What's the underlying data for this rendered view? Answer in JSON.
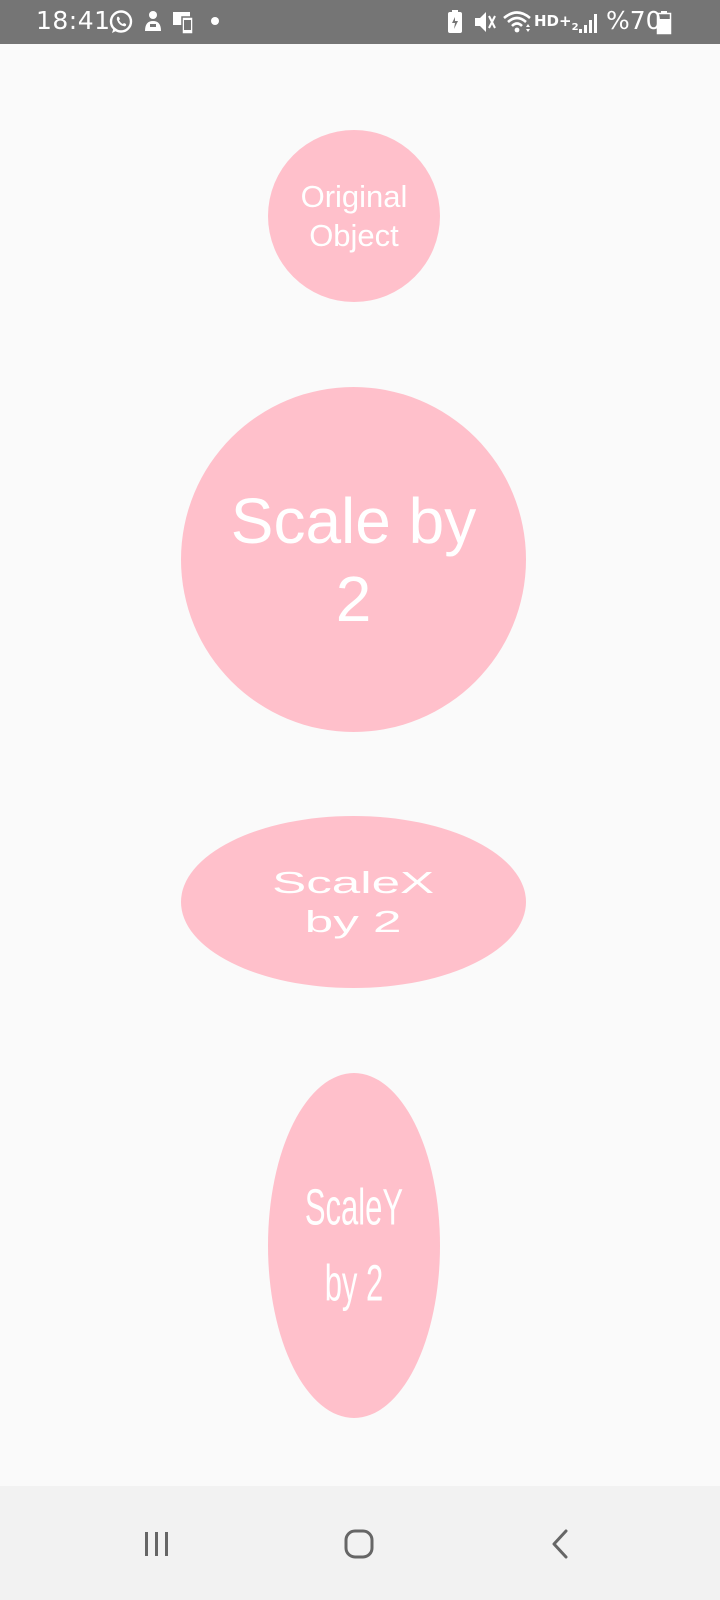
{
  "status_bar": {
    "time": "18:41",
    "network": "HD+",
    "network_sub": "2",
    "battery": "%70",
    "icons": [
      "whatsapp-icon",
      "notification-app-icon",
      "screen-mirror-icon",
      "dot-icon",
      "battery-saver-icon",
      "mute-icon",
      "wifi-icon",
      "signal-icon",
      "battery-icon"
    ],
    "background": "#757575"
  },
  "shapes": {
    "original": {
      "label": "Original\nObject"
    },
    "scale": {
      "label": "Scale by\n2"
    },
    "scalex": {
      "label": "ScaleX\nby 2"
    },
    "scaley": {
      "label": "ScaleY\nby 2"
    },
    "fill_color": "#ffc0cb",
    "text_color": "#ffffff"
  },
  "nav_bar": {
    "buttons": [
      "recents-icon",
      "home-icon",
      "back-icon"
    ],
    "background": "#f2f2f2"
  }
}
